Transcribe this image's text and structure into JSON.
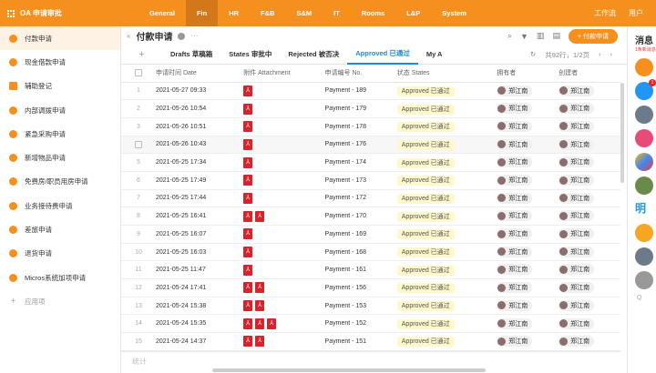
{
  "app": {
    "title": "OA 申请审批",
    "nav": [
      "General",
      "Fin",
      "HR",
      "F&B",
      "S&M",
      "IT",
      "Rooms",
      "L&P",
      "System"
    ],
    "active_nav": 1,
    "right": [
      "工作流",
      "用户"
    ]
  },
  "sidebar": {
    "items": [
      "付款申请",
      "现金借款申请",
      "辅助登记",
      "内部调拨申请",
      "紧急采购申请",
      "新增物品申请",
      "免费房/职员用房申请",
      "业务接待费申请",
      "差旅申请",
      "退货申请",
      "Micros系统加项申请",
      "应用项"
    ]
  },
  "toolbar": {
    "title": "付款申请",
    "add_button": "+ 付款申请"
  },
  "tabs": {
    "items": [
      "Drafts 草稿箱",
      "States 审批中",
      "Rejected 被否决",
      "Approved 已通过",
      "My A"
    ],
    "active": 3,
    "pagination": "共92行，1/2页"
  },
  "table": {
    "headers": [
      "申请时间 Date",
      "附件 Attachment",
      "申请编号 No.",
      "状态 States",
      "拥有者",
      "创建者"
    ],
    "rows": [
      {
        "n": "1",
        "date": "2021-05-27 09:33",
        "att": 1,
        "no": "Payment - 189"
      },
      {
        "n": "2",
        "date": "2021-05-26 10:54",
        "att": 1,
        "no": "Payment - 179"
      },
      {
        "n": "3",
        "date": "2021-05-26 10:51",
        "att": 1,
        "no": "Payment - 178"
      },
      {
        "n": "",
        "date": "2021-05-26 10:43",
        "att": 1,
        "no": "Payment - 176"
      },
      {
        "n": "5",
        "date": "2021-05-25 17:34",
        "att": 1,
        "no": "Payment - 174"
      },
      {
        "n": "6",
        "date": "2021-05-25 17:49",
        "att": 1,
        "no": "Payment - 173"
      },
      {
        "n": "7",
        "date": "2021-05-25 17:44",
        "att": 1,
        "no": "Payment - 172"
      },
      {
        "n": "8",
        "date": "2021-05-25 16:41",
        "att": 2,
        "no": "Payment - 170"
      },
      {
        "n": "9",
        "date": "2021-05-25 16:07",
        "att": 1,
        "no": "Payment - 169"
      },
      {
        "n": "10",
        "date": "2021-05-25 16:03",
        "att": 1,
        "no": "Payment - 168"
      },
      {
        "n": "11",
        "date": "2021-05-25 11:47",
        "att": 1,
        "no": "Payment - 161"
      },
      {
        "n": "12",
        "date": "2021-05-24 17:41",
        "att": 2,
        "no": "Payment - 156"
      },
      {
        "n": "13",
        "date": "2021-05-24 15:38",
        "att": 2,
        "no": "Payment - 153"
      },
      {
        "n": "14",
        "date": "2021-05-24 15:35",
        "att": 3,
        "no": "Payment - 152"
      },
      {
        "n": "15",
        "date": "2021-05-24 14:37",
        "att": 2,
        "no": "Payment - 151"
      }
    ],
    "status": "Approved 已通过",
    "user": "郑江南",
    "footer": "统计"
  },
  "messages": {
    "title": "消息",
    "subtitle": "1条新消息",
    "badge": "1",
    "search_label": "Q"
  }
}
